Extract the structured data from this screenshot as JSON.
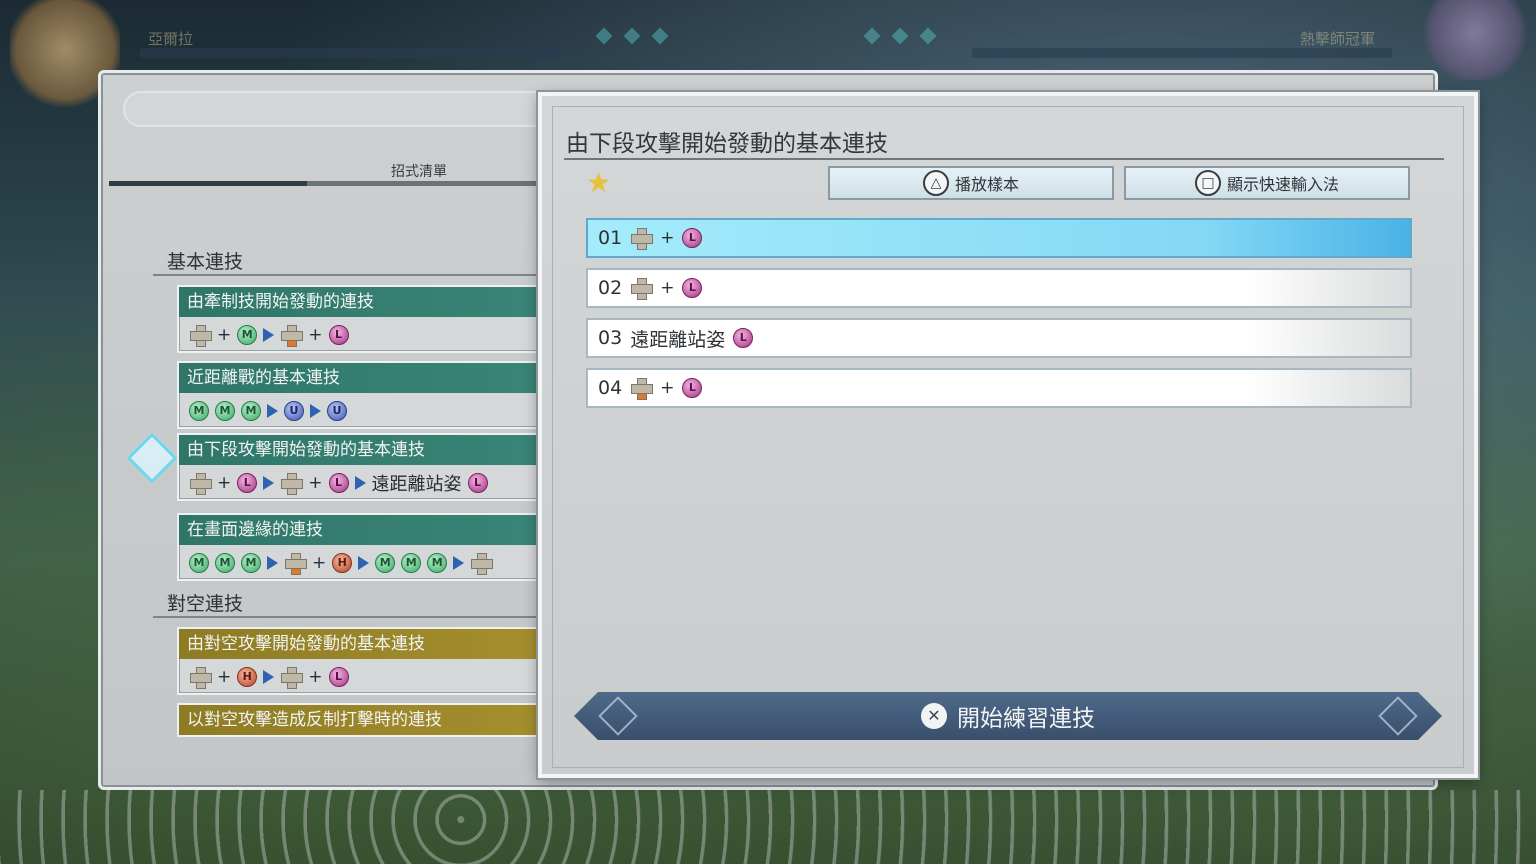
{
  "hud": {
    "player_left_name": "亞爾拉",
    "player_right_name": "熱擊師冠軍"
  },
  "move_list": {
    "title": "招式清單",
    "sections": [
      {
        "heading": "基本連技",
        "combos": [
          {
            "title": "由牽制技開始發動的連技",
            "color": "green",
            "inputs": [
              "dpad",
              "+",
              "M",
              "arrow",
              "dpad-hl",
              "+",
              "L"
            ]
          },
          {
            "title": "近距離戰的基本連技",
            "color": "green",
            "inputs": [
              "M",
              "M",
              "M",
              "arrow",
              "U",
              "arrow",
              "U"
            ]
          },
          {
            "title": "由下段攻擊開始發動的基本連技",
            "color": "green",
            "inputs": [
              "dpad",
              "+",
              "L",
              "arrow",
              "dpad",
              "+",
              "L",
              "arrow",
              "txt:遠距離站姿",
              "L"
            ]
          },
          {
            "title": "在畫面邊緣的連技",
            "color": "green",
            "inputs": [
              "M",
              "M",
              "M",
              "arrow",
              "dpad-hl",
              "+",
              "H",
              "arrow",
              "M",
              "M",
              "M",
              "arrow",
              "dpad"
            ]
          }
        ]
      },
      {
        "heading": "對空連技",
        "combos": [
          {
            "title": "由對空攻擊開始發動的基本連技",
            "color": "gold",
            "inputs": [
              "dpad",
              "+",
              "H",
              "arrow",
              "dpad",
              "+",
              "L"
            ]
          },
          {
            "title": "以對空攻擊造成反制打擊時的連技",
            "color": "gold",
            "inputs": []
          }
        ]
      }
    ]
  },
  "dialog": {
    "title": "由下段攻擊開始發動的基本連技",
    "play_sample_label": "播放樣本",
    "play_sample_button_glyph": "△",
    "show_quick_input_label": "顯示快速輸入法",
    "show_quick_input_button_glyph": "□",
    "rows": [
      {
        "num": "01",
        "text": "",
        "inputs": [
          "dpad",
          "+",
          "L"
        ],
        "active": true
      },
      {
        "num": "02",
        "text": "",
        "inputs": [
          "dpad",
          "+",
          "L"
        ],
        "active": false
      },
      {
        "num": "03",
        "text": "遠距離站姿",
        "inputs": [
          "L"
        ],
        "active": false
      },
      {
        "num": "04",
        "text": "",
        "inputs": [
          "dpad-hl",
          "+",
          "L"
        ],
        "active": false
      }
    ],
    "start_practice_label": "開始練習連技",
    "start_practice_button_glyph": "✕"
  },
  "button_glyphs": {
    "M": "M",
    "L": "L",
    "U": "U",
    "H": "H"
  },
  "colors": {
    "accent_green": "#2f7669",
    "accent_gold": "#8e7b23",
    "active_row": "#84d8f5",
    "practice_bar": "#394f6c"
  }
}
